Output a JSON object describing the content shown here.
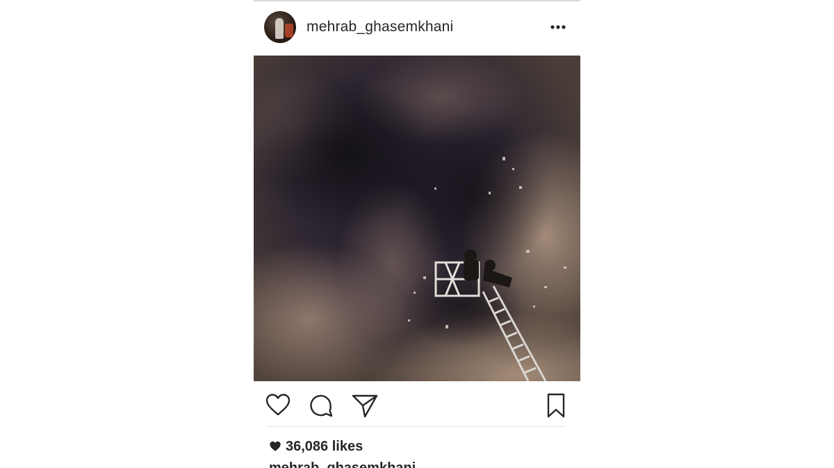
{
  "post": {
    "author": {
      "username": "mehrab_ghasemkhani"
    },
    "header": {
      "more_icon": "more-horizontal-icon"
    },
    "actions": [
      {
        "name": "like",
        "icon": "heart-outline-icon"
      },
      {
        "name": "comment",
        "icon": "comment-bubble-icon"
      },
      {
        "name": "share",
        "icon": "paper-plane-icon"
      },
      {
        "name": "save",
        "icon": "bookmark-icon"
      }
    ],
    "likes": {
      "icon": "heart-filled-icon",
      "label": "36,086 likes"
    },
    "caption": {
      "author": "mehrab_ghasemkhani"
    },
    "photo": {
      "subject": "firefighter ladder amid smoke"
    },
    "colors": {
      "text": "#262626",
      "divider": "#e3e3e3",
      "smoke_dark": "#2a2230",
      "smoke_light": "#a48a74"
    }
  }
}
